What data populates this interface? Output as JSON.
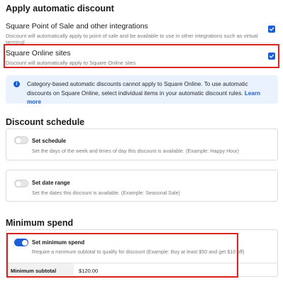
{
  "apply_section": {
    "title": "Apply automatic discount",
    "options": [
      {
        "title": "Square Point of Sale and other integrations",
        "description": "Discount will automatically apply to point of sale and be available to use in other integrations such as virtual terminal",
        "checked": true
      },
      {
        "title": "Square Online sites",
        "description": "Discount will automatically apply to Square Online sites",
        "checked": true
      }
    ],
    "info": {
      "text": "Category-based automatic discounts cannot apply to Square Online. To use automatic discounts on Square Online, select individual items in your automatic discount rules.",
      "link": "Learn more"
    }
  },
  "schedule_section": {
    "title": "Discount schedule",
    "set_schedule": {
      "title": "Set schedule",
      "description": "Set the days of the week and times of day this discount is available. (Example: Happy Hour)",
      "enabled": false
    },
    "set_date_range": {
      "title": "Set date range",
      "description": "Set the dates this discount is available. (Example: Seasonal Sale)",
      "enabled": false
    }
  },
  "min_spend_section": {
    "title": "Minimum spend",
    "set_minimum_spend": {
      "title": "Set minimum spend",
      "description": "Require a minimum subtotal to qualify for discount (Example: Buy at least $50 and get $10 off)",
      "enabled": true
    },
    "subtotal": {
      "label": "Minimum subtotal",
      "value": "$120.00"
    }
  },
  "colors": {
    "accent": "#1a5fd6",
    "highlight_border": "#d9241c",
    "info_background": "#eaf2fd"
  }
}
